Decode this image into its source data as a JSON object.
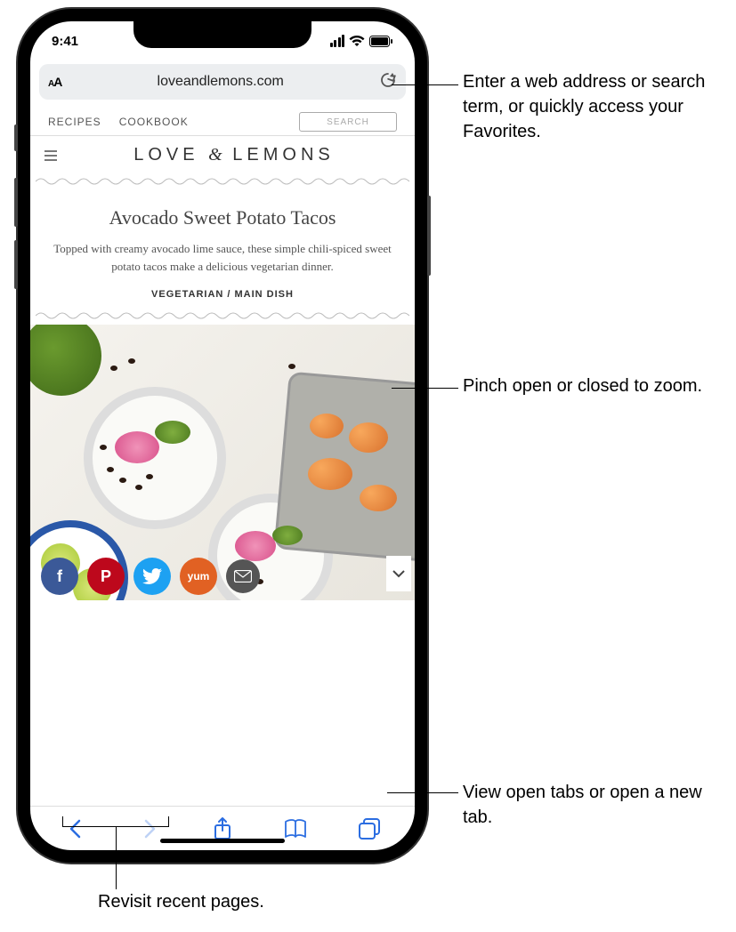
{
  "status": {
    "time": "9:41"
  },
  "addressbar": {
    "url": "loveandlemons.com"
  },
  "site": {
    "nav": {
      "recipes": "RECIPES",
      "cookbook": "COOKBOOK",
      "search_placeholder": "SEARCH"
    },
    "logo": {
      "pre": "LOVE",
      "amp": "&",
      "post": "LEMONS"
    }
  },
  "article": {
    "title": "Avocado Sweet Potato Tacos",
    "desc": "Topped with creamy avocado lime sauce, these simple chili-spiced sweet potato tacos make a delicious vegetarian dinner.",
    "meta": "VEGETARIAN / MAIN DISH"
  },
  "social": {
    "fb": "f",
    "pin": "P",
    "tw": "t",
    "yum": "yum"
  },
  "callouts": {
    "address": "Enter a web address or search term, or quickly access your Favorites.",
    "zoom": "Pinch open or closed to zoom.",
    "tabs": "View open tabs or open a new tab.",
    "recent": "Revisit recent pages."
  }
}
